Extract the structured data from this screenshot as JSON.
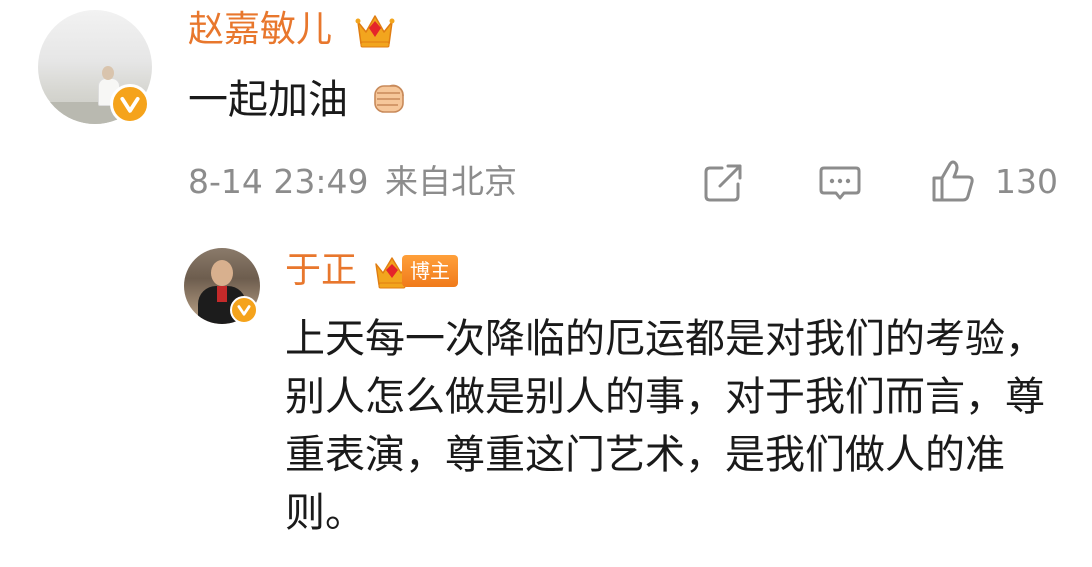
{
  "comment": {
    "author": "赵嘉敏儿",
    "text": "一起加油",
    "emoji": "fist-emoji",
    "time": "8-14 23:49",
    "location": "来自北京",
    "like_count": "130"
  },
  "reply": {
    "author": "于正",
    "badge": "博主",
    "text": "上天每一次降临的厄运都是对我们的考验，别人怎么做是别人的事，对于我们而言，尊重表演，尊重这门艺术，是我们做人的准则。"
  },
  "colors": {
    "username": "#e8772d",
    "meta": "#8c8c8c",
    "verified": "#f5a31b",
    "badge": "#f07a1b"
  },
  "icons": [
    "verified-icon",
    "crown-icon",
    "share-icon",
    "comment-icon",
    "like-icon"
  ]
}
